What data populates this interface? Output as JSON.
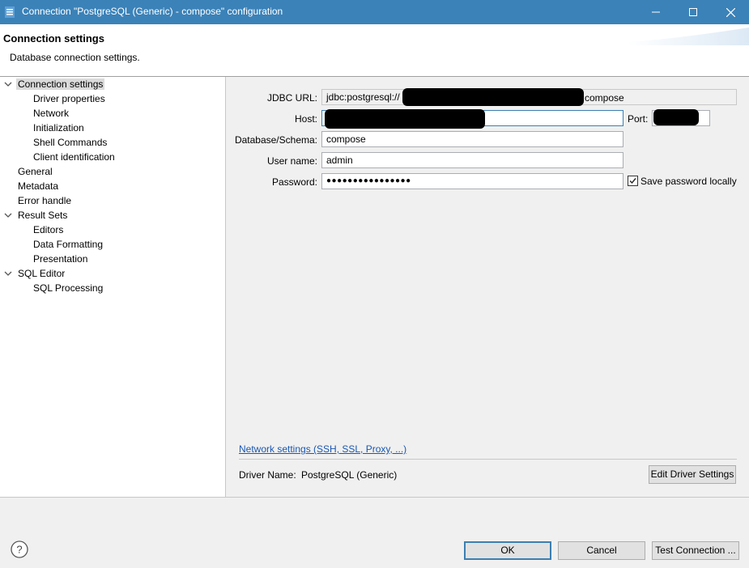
{
  "window": {
    "title": "Connection \"PostgreSQL (Generic) - compose\" configuration",
    "minimize_glyph": "—",
    "maximize_glyph": "☐",
    "close_glyph": "✕"
  },
  "header": {
    "title": "Connection settings",
    "description": "Database connection settings."
  },
  "tree": {
    "items": [
      {
        "label": "Connection settings",
        "expanded": true,
        "selected": true
      },
      {
        "label": "Driver properties"
      },
      {
        "label": "Network"
      },
      {
        "label": "Initialization"
      },
      {
        "label": "Shell Commands"
      },
      {
        "label": "Client identification"
      },
      {
        "label": "General"
      },
      {
        "label": "Metadata"
      },
      {
        "label": "Error handle"
      },
      {
        "label": "Result Sets",
        "expanded": true
      },
      {
        "label": "Editors"
      },
      {
        "label": "Data Formatting"
      },
      {
        "label": "Presentation"
      },
      {
        "label": "SQL Editor",
        "expanded": true
      },
      {
        "label": "SQL Processing"
      }
    ]
  },
  "form": {
    "jdbc_label": "JDBC URL:",
    "jdbc_prefix": "jdbc:postgresql://",
    "jdbc_suffix": "compose",
    "host_label": "Host:",
    "port_label": "Port:",
    "database_label": "Database/Schema:",
    "database_value": "compose",
    "username_label": "User name:",
    "username_value": "admin",
    "password_label": "Password:",
    "password_value": "●●●●●●●●●●●●●●●●",
    "save_password_label": "Save password locally",
    "save_password_checked": true
  },
  "network_link": "Network settings (SSH, SSL, Proxy, ...)",
  "driver": {
    "label": "Driver Name:",
    "value": "PostgreSQL (Generic)",
    "edit_button": "Edit Driver Settings"
  },
  "footer": {
    "ok": "OK",
    "cancel": "Cancel",
    "test": "Test Connection ...",
    "help_glyph": "?"
  },
  "colors": {
    "titlebar": "#3b82b8",
    "link": "#1a57b0",
    "focus_border": "#3c7fb1"
  }
}
